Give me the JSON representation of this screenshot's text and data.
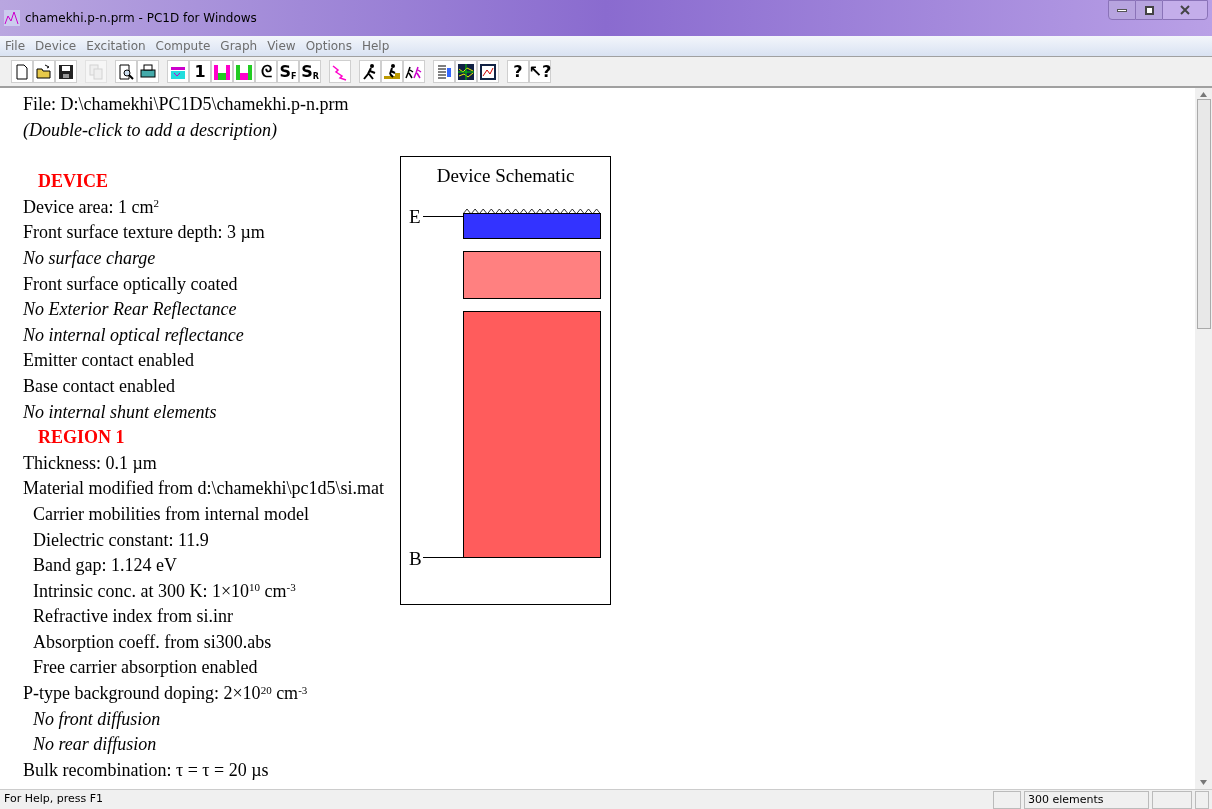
{
  "window": {
    "title": "chamekhi.p-n.prm - PC1D for Windows"
  },
  "menu": [
    "File",
    "Device",
    "Excitation",
    "Compute",
    "Graph",
    "View",
    "Options",
    "Help"
  ],
  "toolbar": [
    {
      "kind": "icon",
      "disabled": false
    },
    {
      "kind": "icon",
      "disabled": false
    },
    {
      "kind": "icon",
      "disabled": false
    },
    {
      "kind": "gap"
    },
    {
      "kind": "icon",
      "disabled": true
    },
    {
      "kind": "gap"
    },
    {
      "kind": "icon",
      "disabled": false
    },
    {
      "kind": "icon",
      "disabled": false
    },
    {
      "kind": "gap"
    },
    {
      "kind": "icon",
      "disabled": false
    },
    {
      "kind": "text",
      "label": "1"
    },
    {
      "kind": "icon",
      "disabled": false
    },
    {
      "kind": "icon",
      "disabled": false
    },
    {
      "kind": "text",
      "label": "ᘓ"
    },
    {
      "kind": "text",
      "label": "S$_{F}$"
    },
    {
      "kind": "text",
      "label": "S$_{R}$"
    },
    {
      "kind": "gap"
    },
    {
      "kind": "icon",
      "disabled": false
    },
    {
      "kind": "gap"
    },
    {
      "kind": "icon",
      "disabled": false
    },
    {
      "kind": "icon",
      "disabled": false
    },
    {
      "kind": "icon",
      "disabled": false
    },
    {
      "kind": "gap"
    },
    {
      "kind": "icon",
      "disabled": false
    },
    {
      "kind": "icon",
      "disabled": false
    },
    {
      "kind": "icon",
      "disabled": false
    },
    {
      "kind": "gap"
    },
    {
      "kind": "text",
      "label": "?"
    },
    {
      "kind": "text",
      "label": "↖?"
    }
  ],
  "document": {
    "file": "File: D:\\chamekhi\\PC1D5\\chamekhi.p-n.prm",
    "description": "(Double-click to add a description)",
    "lines": [
      {
        "kind": "heading",
        "text": "DEVICE"
      },
      {
        "kind": "text",
        "text": "Device area: 1 cm$^{2}$"
      },
      {
        "kind": "text",
        "text": "Front surface texture depth: 3 µm"
      },
      {
        "kind": "note",
        "text": "No surface charge"
      },
      {
        "kind": "text",
        "text": "Front surface optically coated"
      },
      {
        "kind": "note",
        "text": "No Exterior Rear Reflectance"
      },
      {
        "kind": "note",
        "text": "No internal optical reflectance"
      },
      {
        "kind": "text",
        "text": "Emitter contact enabled"
      },
      {
        "kind": "text",
        "text": "Base contact enabled"
      },
      {
        "kind": "note",
        "text": "No internal shunt elements"
      },
      {
        "kind": "heading",
        "text": "REGION 1"
      },
      {
        "kind": "text",
        "text": "Thickness: 0.1 µm"
      },
      {
        "kind": "text",
        "text": "Material modified from d:\\chamekhi\\pc1d5\\si.mat"
      },
      {
        "kind": "sub",
        "text": "Carrier mobilities from internal model"
      },
      {
        "kind": "sub",
        "text": "Dielectric constant: 11.9"
      },
      {
        "kind": "sub",
        "text": "Band gap: 1.124 eV"
      },
      {
        "kind": "sub",
        "text": "Intrinsic conc. at 300 K: 1×10$^{10}$ cm$^{-3}$"
      },
      {
        "kind": "sub",
        "text": "Refractive index from si.inr"
      },
      {
        "kind": "sub",
        "text": "Absorption coeff. from si300.abs"
      },
      {
        "kind": "sub",
        "text": "Free carrier absorption enabled"
      },
      {
        "kind": "text",
        "text": "P-type background doping: 2×10$^{20}$ cm$^{-3}$"
      },
      {
        "kind": "subnote",
        "text": "No front diffusion"
      },
      {
        "kind": "subnote",
        "text": "No rear diffusion"
      },
      {
        "kind": "text",
        "text": "Bulk recombination: τ = τ = 20 µs"
      }
    ]
  },
  "schematic": {
    "title": "Device Schematic",
    "top_label": "E",
    "bottom_label": "B",
    "layers": [
      {
        "color": "#3333ff",
        "textured": true
      },
      {
        "color": "#ff8080",
        "textured": false
      },
      {
        "color": "#ff5c5c",
        "textured": false
      }
    ]
  },
  "status_bar": {
    "message": "For Help, press F1",
    "element_count": "300 elements"
  }
}
